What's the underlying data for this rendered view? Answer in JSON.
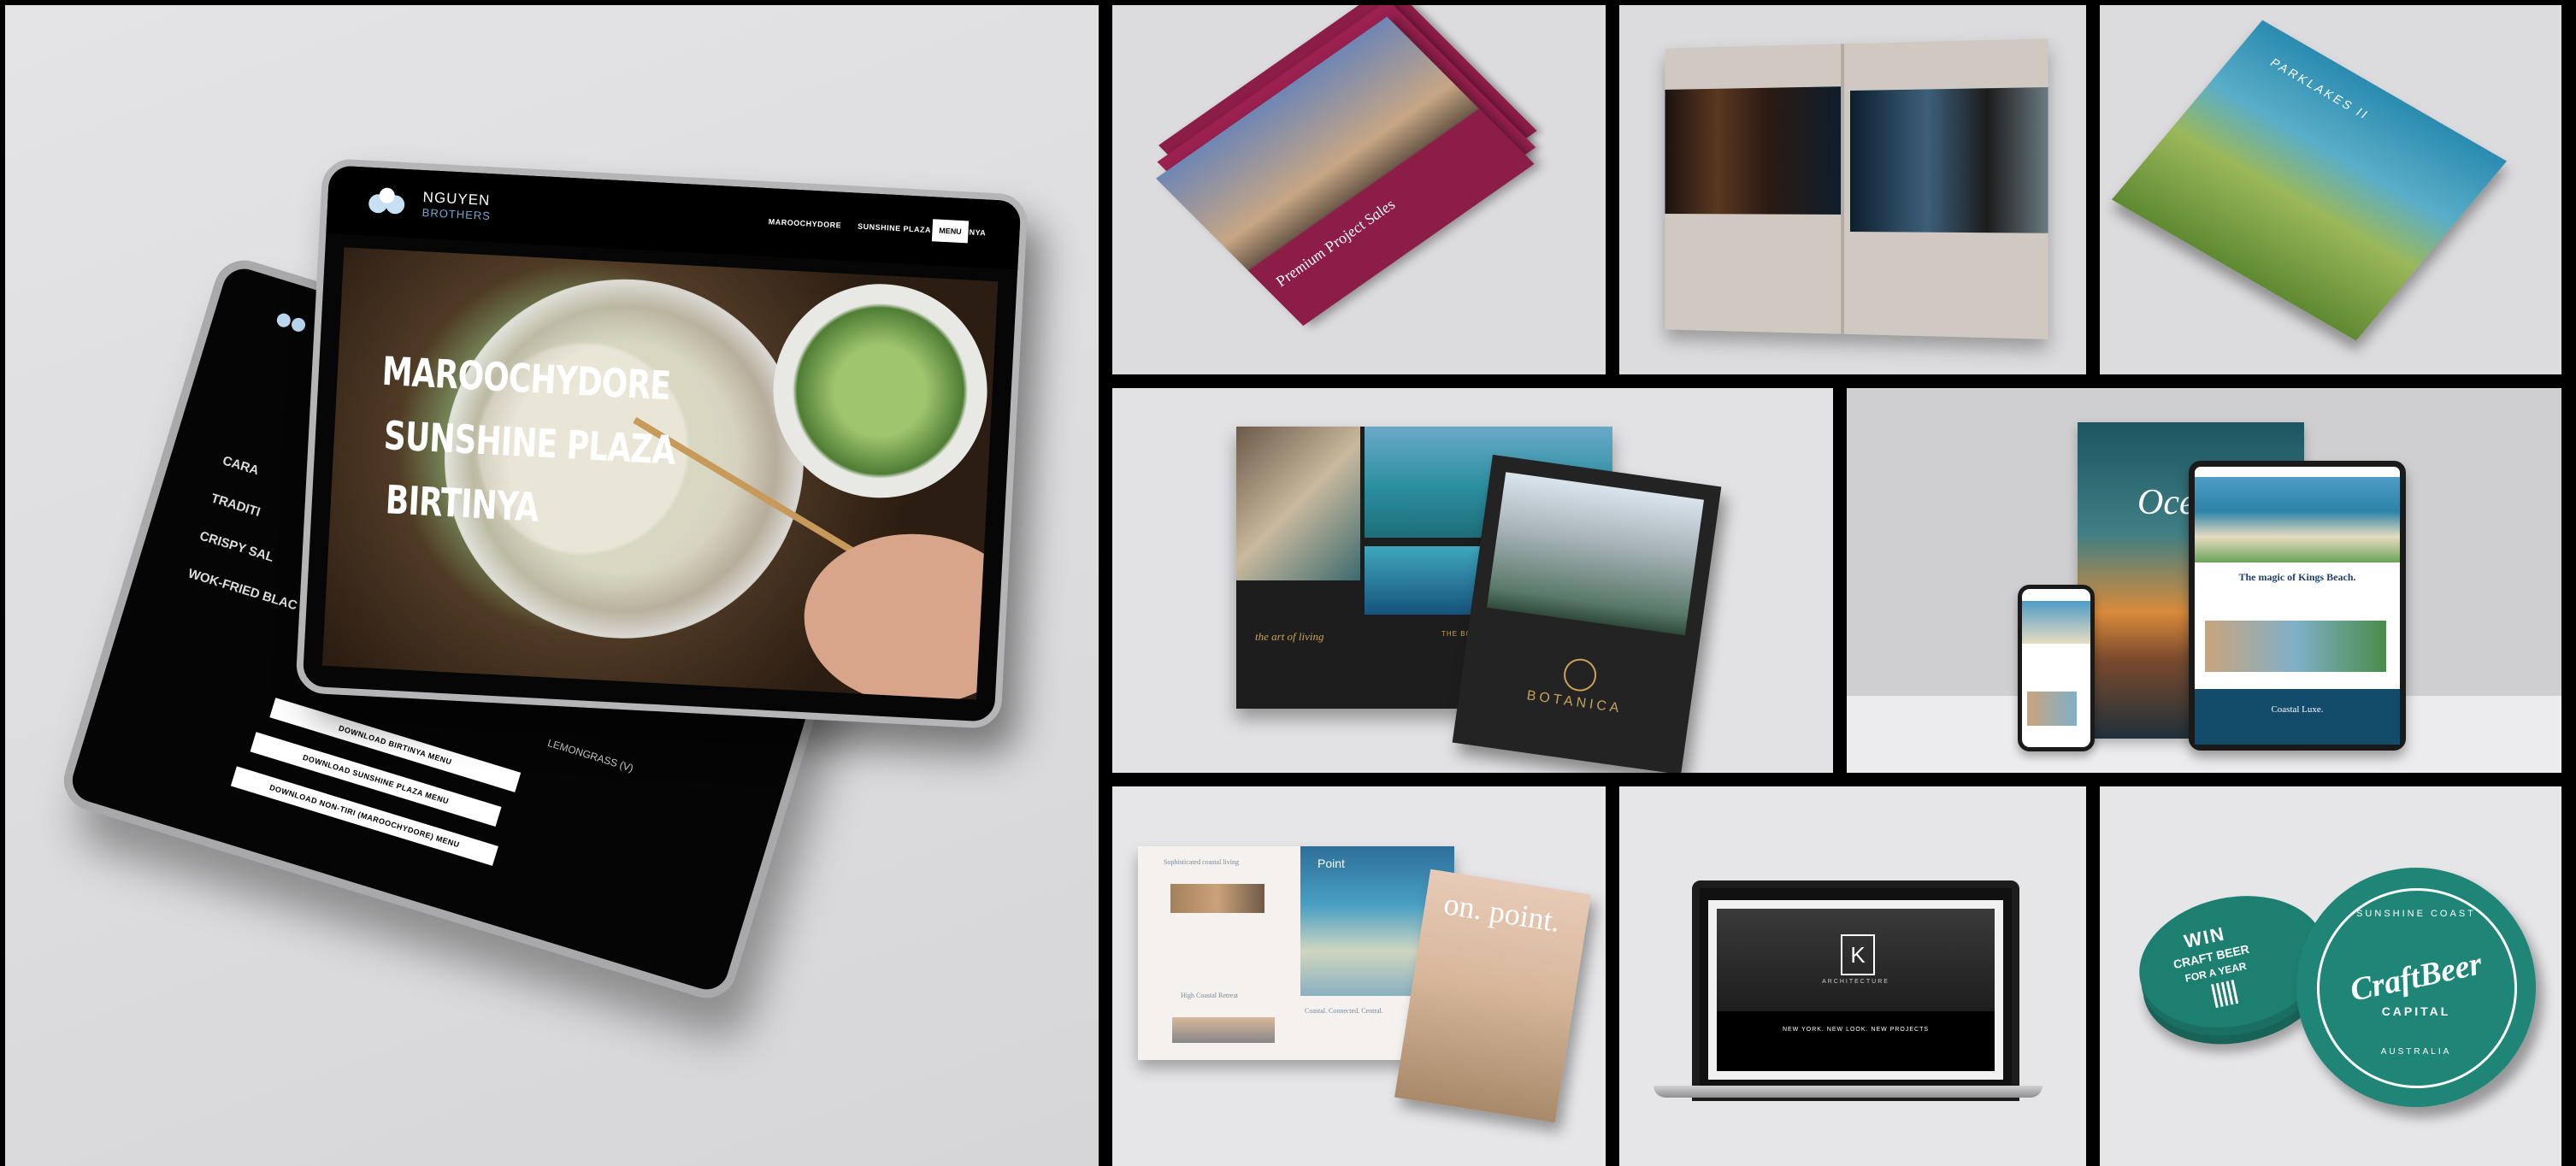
{
  "collage": {
    "background": "#000000",
    "panel_bg": "#dcdcde"
  },
  "nguyen": {
    "logo_top": "NGUYEN",
    "logo_bottom": "BROTHERS",
    "nav": [
      "MAROOCHYDORE",
      "SUNSHINE PLAZA",
      "BIRTINYA"
    ],
    "menu_button": "MENU",
    "hero_locations": [
      "MAROOCHYDORE",
      "SUNSHINE PLAZA",
      "BIRTINYA"
    ],
    "back_menu_lines": [
      "CARA",
      "TRADITI",
      "CRISPY SAL",
      "WOK-FRIED BLAC",
      "LEMONGRASS (V)"
    ],
    "downloads": [
      "DOWNLOAD BIRTINYA MENU",
      "DOWNLOAD SUNSHINE PLAZA MENU",
      "DOWNLOAD NON-TIRI (MAROOCHYDORE) MENU"
    ]
  },
  "brochure_premium": {
    "title": "Premium Project Sales"
  },
  "parklakes": {
    "title": "PARKLAKES II"
  },
  "botanica": {
    "brand": "BOTANICA",
    "tagline": "the art of living",
    "section": "THE BOTANICA"
  },
  "kings_beach": {
    "poster_word": "Oce",
    "headline": "The magic of Kings Beach.",
    "footer": "Coastal Luxe."
  },
  "onpoint": {
    "cover": "on. point.",
    "mag_title": "Point",
    "headline_1": "Sophisticated coastal living",
    "headline_2": "High Coastal Retreat",
    "headline_3": "Coastal. Connected. Central."
  },
  "architecture": {
    "logo": "K",
    "subtitle": "ARCHITECTURE",
    "caption": "NEW YORK. NEW LOOK. NEW PROJECTS"
  },
  "craftbeer": {
    "win_line_1": "WIN",
    "win_line_2": "CRAFT BEER",
    "win_line_3": "FOR A YEAR",
    "brand": "CraftBeer",
    "capital": "CAPITAL",
    "region": "SUNSHINE COAST",
    "country": "AUSTRALIA"
  }
}
